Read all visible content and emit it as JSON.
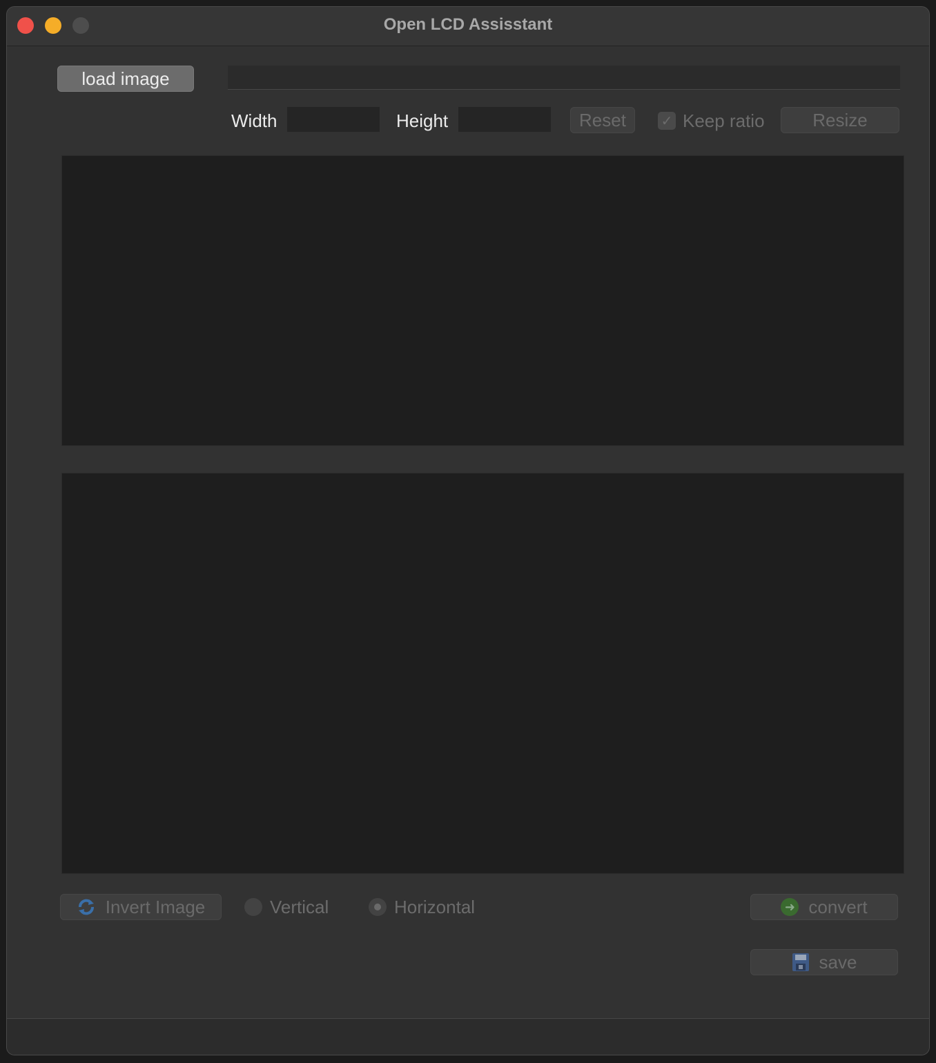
{
  "window": {
    "title": "Open LCD Assisstant"
  },
  "toolbar": {
    "load_image_label": "load image",
    "file_path_value": "",
    "width_label": "Width",
    "width_value": "",
    "height_label": "Height",
    "height_value": "",
    "reset_label": "Reset",
    "keep_ratio_label": "Keep ratio",
    "keep_ratio_checked": true,
    "resize_label": "Resize"
  },
  "bottom_controls": {
    "invert_label": "Invert Image",
    "vertical_label": "Vertical",
    "horizontal_label": "Horizontal",
    "selected_orientation": "Horizontal",
    "convert_label": "convert",
    "save_label": "save"
  },
  "icons": {
    "invert": "refresh-icon",
    "convert": "arrow-right-icon",
    "save": "floppy-disk-icon"
  },
  "colors": {
    "window_bg": "#323232",
    "panel_bg": "#1e1e1e",
    "close": "#f0514a",
    "minimize": "#f5ad28",
    "maximize": "#4d4d4d"
  }
}
